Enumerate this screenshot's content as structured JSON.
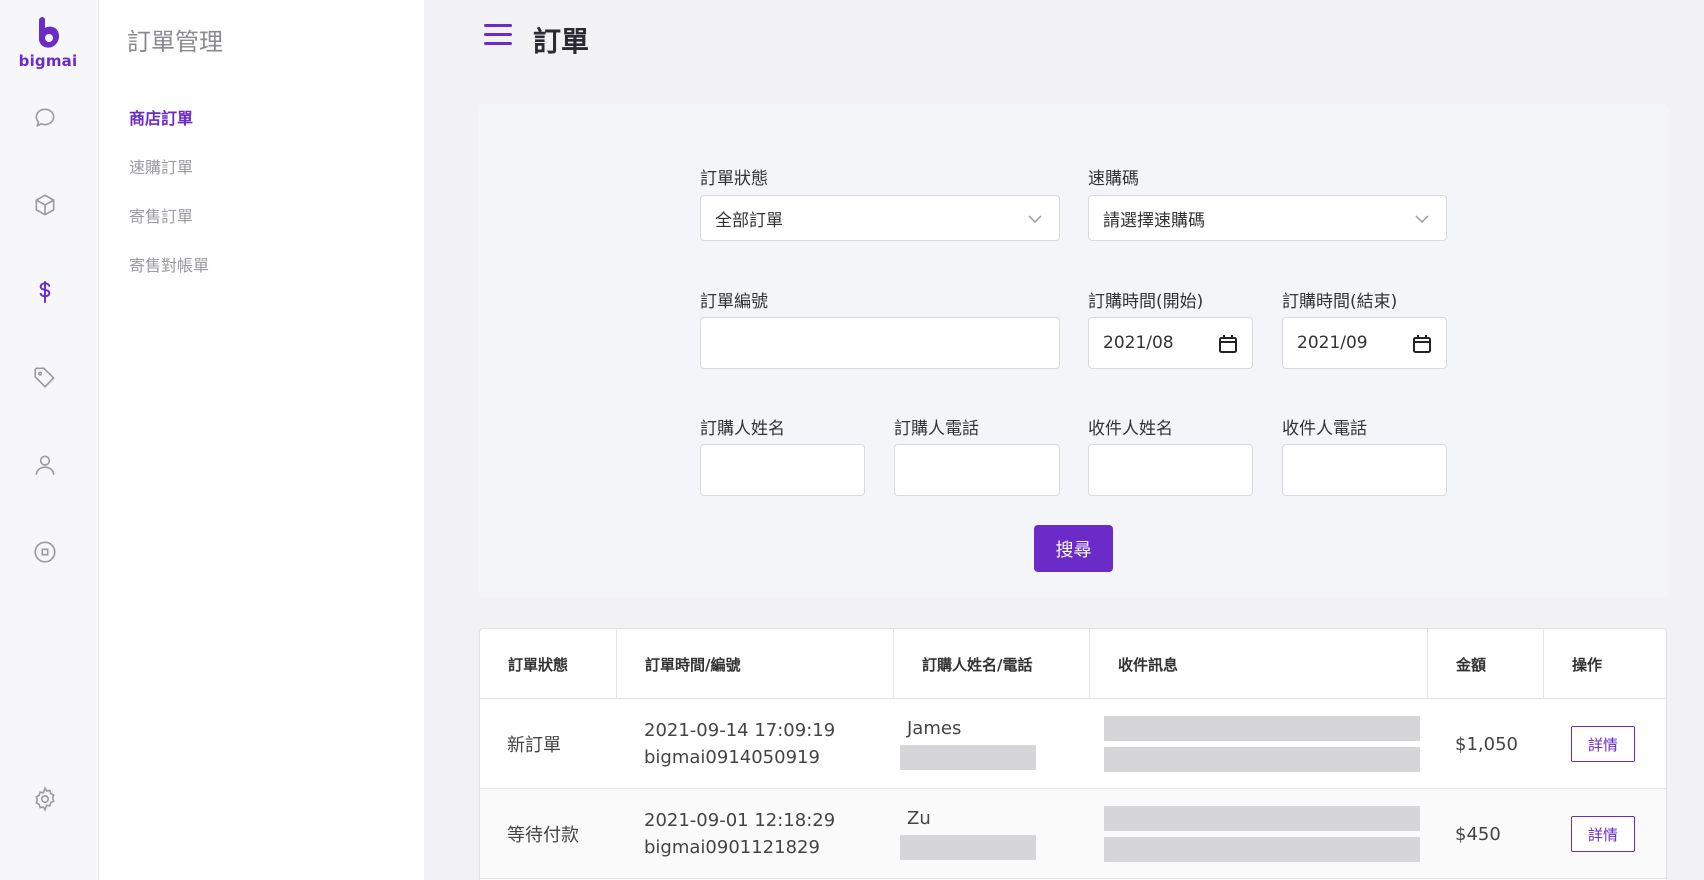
{
  "brand": {
    "logo_text": "bigmai",
    "accent": "#6a2bc8"
  },
  "rail": {
    "icons": [
      "chat-icon",
      "box-icon",
      "dollar-icon",
      "tag-icon",
      "user-icon",
      "coin-icon",
      "gear-icon"
    ],
    "active": "dollar-icon"
  },
  "subnav": {
    "title": "訂單管理",
    "items": [
      {
        "label": "商店訂單",
        "active": true
      },
      {
        "label": "速購訂單",
        "active": false
      },
      {
        "label": "寄售訂單",
        "active": false
      },
      {
        "label": "寄售對帳單",
        "active": false
      }
    ]
  },
  "page": {
    "title": "訂單"
  },
  "filters": {
    "order_status_label": "訂單狀態",
    "order_status_value": "全部訂單",
    "quick_code_label": "速購碼",
    "quick_code_placeholder": "請選擇速購碼",
    "order_no_label": "訂單編號",
    "order_no_value": "",
    "start_label": "訂購時間(開始)",
    "start_value": "2021/08",
    "end_label": "訂購時間(結束)",
    "end_value": "2021/09",
    "buyer_name_label": "訂購人姓名",
    "buyer_phone_label": "訂購人電話",
    "receiver_name_label": "收件人姓名",
    "receiver_phone_label": "收件人電話",
    "search_label": "搜尋"
  },
  "table": {
    "headers": [
      "訂單狀態",
      "訂單時間/編號",
      "訂購人姓名/電話",
      "收件訊息",
      "金額",
      "操作"
    ],
    "rows": [
      {
        "status": "新訂單",
        "time": "2021-09-14 17:09:19",
        "order_no": "bigmai0914050919",
        "buyer": "James",
        "amount": "$1,050",
        "action": "詳情"
      },
      {
        "status": "等待付款",
        "time": "2021-09-01 12:18:29",
        "order_no": "bigmai0901121829",
        "buyer": "Zu",
        "amount": "$450",
        "action": "詳情"
      }
    ]
  }
}
